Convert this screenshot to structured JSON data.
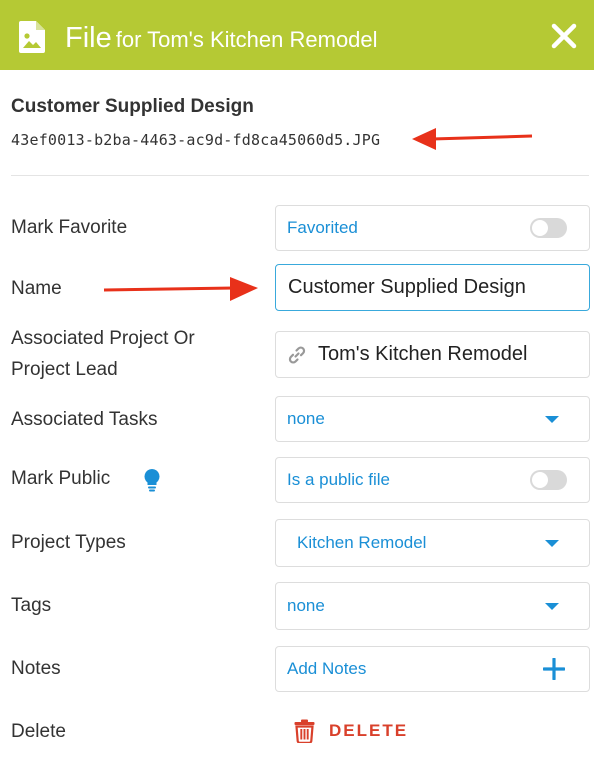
{
  "header": {
    "title": "File",
    "subtitle": "for Tom's Kitchen Remodel",
    "icon": "file-image-icon",
    "close_icon": "close-icon",
    "color": "#b5c934"
  },
  "file": {
    "title": "Customer Supplied Design",
    "filename": "43ef0013-b2ba-4463-ac9d-fd8ca45060d5.JPG"
  },
  "fields": {
    "favorite": {
      "label": "Mark Favorite",
      "value": "Favorited",
      "on": false
    },
    "name": {
      "label": "Name",
      "value": "Customer Supplied Design"
    },
    "project": {
      "label_line1": "Associated Project Or",
      "label_line2": "Project Lead",
      "value": "Tom's Kitchen Remodel",
      "icon": "link-icon"
    },
    "tasks": {
      "label": "Associated Tasks",
      "value": "none"
    },
    "public": {
      "label": "Mark Public",
      "value": "Is a public file",
      "on": false,
      "icon": "lightbulb-icon"
    },
    "project_types": {
      "label": "Project Types",
      "value": "Kitchen Remodel"
    },
    "tags": {
      "label": "Tags",
      "value": "none"
    },
    "notes": {
      "label": "Notes",
      "value": "Add Notes",
      "icon": "plus-icon"
    },
    "delete": {
      "label": "Delete",
      "button": "DELETE",
      "icon": "trash-icon"
    }
  },
  "colors": {
    "accent_blue": "#1a8fd6",
    "danger": "#d9402b",
    "annotation_arrow": "#e8311a"
  }
}
